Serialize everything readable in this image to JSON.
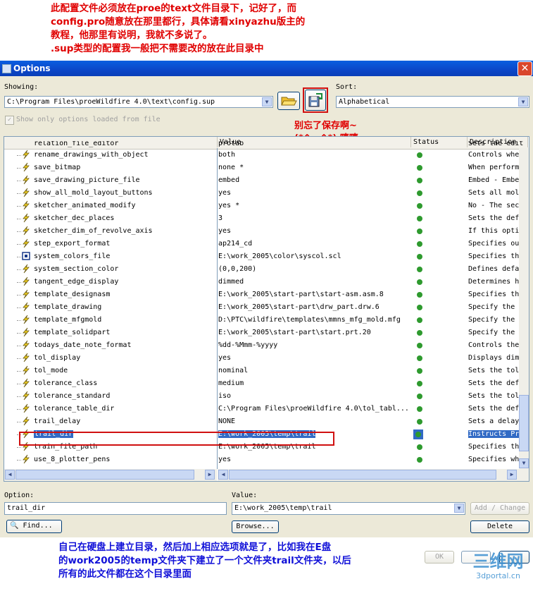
{
  "annotations": {
    "top_red": [
      "此配置文件必须放在proe的text文件目录下，记好了，而",
      "config.pro随意放在那里都行，具体请看xinyazhu版主的",
      "教程，他那里有说明，我就不多说了。",
      ".sup类型的配置我一般把不需要改的放在此目录中"
    ],
    "save_note": [
      "别忘了保存啊~",
      "(*^__^*) 嘻嘻……"
    ],
    "bottom_blue": [
      "自己在硬盘上建立目录，然后加上相应选项就是了，比如我在E盘",
      "的work2005的temp文件夹下建立了一个文件夹trail文件夹，以后",
      "所有的此文件都在这个目录里面"
    ]
  },
  "window": {
    "title": "Options",
    "close_label": "✕"
  },
  "showing": {
    "label": "Showing:",
    "value": "C:\\Program Files\\proeWildfire 4.0\\text\\config.sup"
  },
  "sort": {
    "label": "Sort:",
    "value": "Alphabetical"
  },
  "show_only": {
    "label": "Show only options loaded from file",
    "checked": true
  },
  "columns": {
    "name": "",
    "value": "Value",
    "status": "Status",
    "description": "Description"
  },
  "partial_top_row": {
    "name": "relation_file_editor",
    "value": "protab",
    "description": "Sets the editor"
  },
  "rows": [
    {
      "name": "rename_drawings_with_object",
      "value": "both",
      "description": "Controls whe",
      "icon": "bolt-icon"
    },
    {
      "name": "save_bitmap",
      "value": "none *",
      "description": "When perform",
      "icon": "bolt-icon"
    },
    {
      "name": "save_drawing_picture_file",
      "value": "embed",
      "description": "Embed - Embe",
      "icon": "bolt-icon"
    },
    {
      "name": "show_all_mold_layout_buttons",
      "value": "yes",
      "description": "Sets all mol",
      "icon": "bolt-icon"
    },
    {
      "name": "sketcher_animated_modify",
      "value": "yes *",
      "description": "No - The sec",
      "icon": "bolt-icon"
    },
    {
      "name": "sketcher_dec_places",
      "value": "3",
      "description": "Sets the def",
      "icon": "bolt-icon"
    },
    {
      "name": "sketcher_dim_of_revolve_axis",
      "value": "yes",
      "description": "If this opti",
      "icon": "bolt-icon"
    },
    {
      "name": "step_export_format",
      "value": "ap214_cd",
      "description": "Specifies ou",
      "icon": "bolt-icon"
    },
    {
      "name": "system_colors_file",
      "value": "E:\\work_2005\\color\\syscol.scl",
      "description": "Specifies th",
      "icon": "square-icon"
    },
    {
      "name": "system_section_color",
      "value": "(0,0,200)",
      "description": "Defines defa",
      "icon": "bolt-icon"
    },
    {
      "name": "tangent_edge_display",
      "value": "dimmed",
      "description": "Determines h",
      "icon": "bolt-icon"
    },
    {
      "name": "template_designasm",
      "value": "E:\\work_2005\\start-part\\start-asm.asm.8",
      "description": "Specifies th",
      "icon": "bolt-icon"
    },
    {
      "name": "template_drawing",
      "value": "E:\\work_2005\\start-part\\drw_part.drw.6",
      "description": "Specify the",
      "icon": "bolt-icon"
    },
    {
      "name": "template_mfgmold",
      "value": "D:\\PTC\\wildfire\\templates\\mmns_mfg_mold.mfg",
      "description": "Specify the",
      "icon": "bolt-icon"
    },
    {
      "name": "template_solidpart",
      "value": "E:\\work_2005\\start-part\\start.prt.20",
      "description": "Specify the",
      "icon": "bolt-icon"
    },
    {
      "name": "todays_date_note_format",
      "value": "%dd-%Mmm-%yyyy",
      "description": "Controls the",
      "icon": "bolt-icon"
    },
    {
      "name": "tol_display",
      "value": "yes",
      "description": "Displays dim",
      "icon": "bolt-icon"
    },
    {
      "name": "tol_mode",
      "value": "nominal",
      "description": "Sets the tol",
      "icon": "bolt-icon"
    },
    {
      "name": "tolerance_class",
      "value": "medium",
      "description": "Sets the def",
      "icon": "bolt-icon"
    },
    {
      "name": "tolerance_standard",
      "value": "iso",
      "description": "Sets the tol",
      "icon": "bolt-icon"
    },
    {
      "name": "tolerance_table_dir",
      "value": "C:\\Program Files\\proeWildfire 4.0\\tol_tabl...",
      "description": "Sets the def",
      "icon": "bolt-icon"
    },
    {
      "name": "trail_delay",
      "value": "NONE",
      "description": "Sets a delay",
      "icon": "bolt-icon"
    },
    {
      "name": "trail_dir",
      "value": "E:\\work_2005\\temp\\trail",
      "description": "Instructs Pr",
      "icon": "bolt-icon",
      "selected": true
    },
    {
      "name": "train_file_path",
      "value": "E:\\work_2005\\temp\\trail",
      "description": "Specifies th",
      "icon": "bolt-icon"
    },
    {
      "name": "use_8_plotter_pens",
      "value": "yes",
      "description": "Specifies wh",
      "icon": "bolt-icon"
    }
  ],
  "option": {
    "label": "Option:",
    "value": "trail_dir"
  },
  "value_field": {
    "label": "Value:",
    "value": "E:\\work_2005\\temp\\trail"
  },
  "buttons": {
    "find": "Find...",
    "browse": "Browse...",
    "add_change": "Add / Change",
    "delete": "Delete",
    "ok": "OK"
  },
  "watermark": {
    "brand": "三维网",
    "url": "3dportal.cn"
  },
  "colors": {
    "annotation_red": "#e00000",
    "annotation_blue": "#1010d8",
    "selection": "#316ac5",
    "highlight_box": "#d01010",
    "status_ok": "#2e9a2e"
  }
}
